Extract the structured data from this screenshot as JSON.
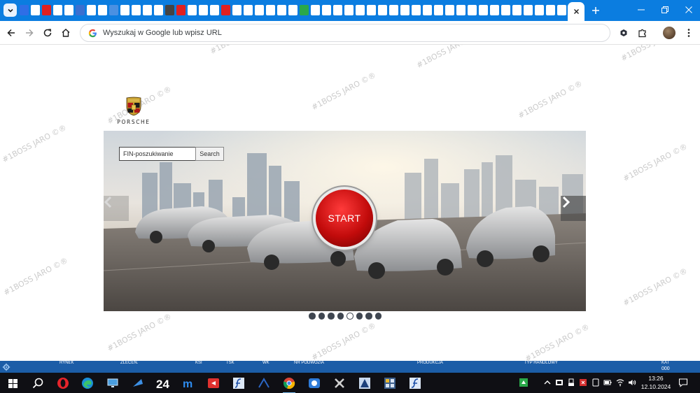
{
  "browser": {
    "address_placeholder": "Wyszukaj w Google lub wpisz URL",
    "pinned_tab_colors": [
      "#2f6ee6",
      "#ffffff",
      "#e02020",
      "#ffffff",
      "#ffffff",
      "#3a6fd0",
      "#ffffff",
      "#ffffff",
      "#4a90e2",
      "#ffffff",
      "#ffffff",
      "#ffffff",
      "#ffffff",
      "#444444",
      "#e02020",
      "#ffffff",
      "#ffffff",
      "#ffffff",
      "#e02020",
      "#ffffff",
      "#ffffff",
      "#ffffff",
      "#ffffff",
      "#ffffff",
      "#ffffff",
      "#2aa84a",
      "#ffffff",
      "#ffffff",
      "#ffffff",
      "#ffffff",
      "#ffffff",
      "#ffffff",
      "#ffffff",
      "#ffffff",
      "#ffffff",
      "#ffffff",
      "#ffffff",
      "#ffffff",
      "#ffffff",
      "#ffffff",
      "#ffffff",
      "#ffffff",
      "#ffffff",
      "#ffffff",
      "#ffffff",
      "#ffffff",
      "#ffffff",
      "#ffffff",
      "#ffffff",
      "#ffffff",
      "#ffffff",
      "#ffffff",
      "#ffffff",
      "#ffffff",
      "#e02020",
      "#ffffff",
      "#ffffff",
      "#ffffff",
      "#ffffff",
      "#ffffff",
      "#ffffff",
      "#ffffff",
      "#2f6ee6"
    ]
  },
  "page": {
    "logo_text": "PORSCHE",
    "search": {
      "placeholder": "FIN-poszukiwanie",
      "button": "Search"
    },
    "start_label": "START",
    "carousel": {
      "total": 8,
      "active": 5
    },
    "watermark": "#1BOSS JARO ©®"
  },
  "app_statusbar": {
    "items": [
      "RYNEK",
      "ZLECEN.",
      "KSI",
      "TSK",
      "WK",
      "NR PODWOZIA",
      "PRODUKCJA",
      "TYP HANDLOWY",
      "KAT"
    ],
    "value": "000"
  },
  "taskbar": {
    "time": "13:26",
    "date": "12.10.2024"
  }
}
